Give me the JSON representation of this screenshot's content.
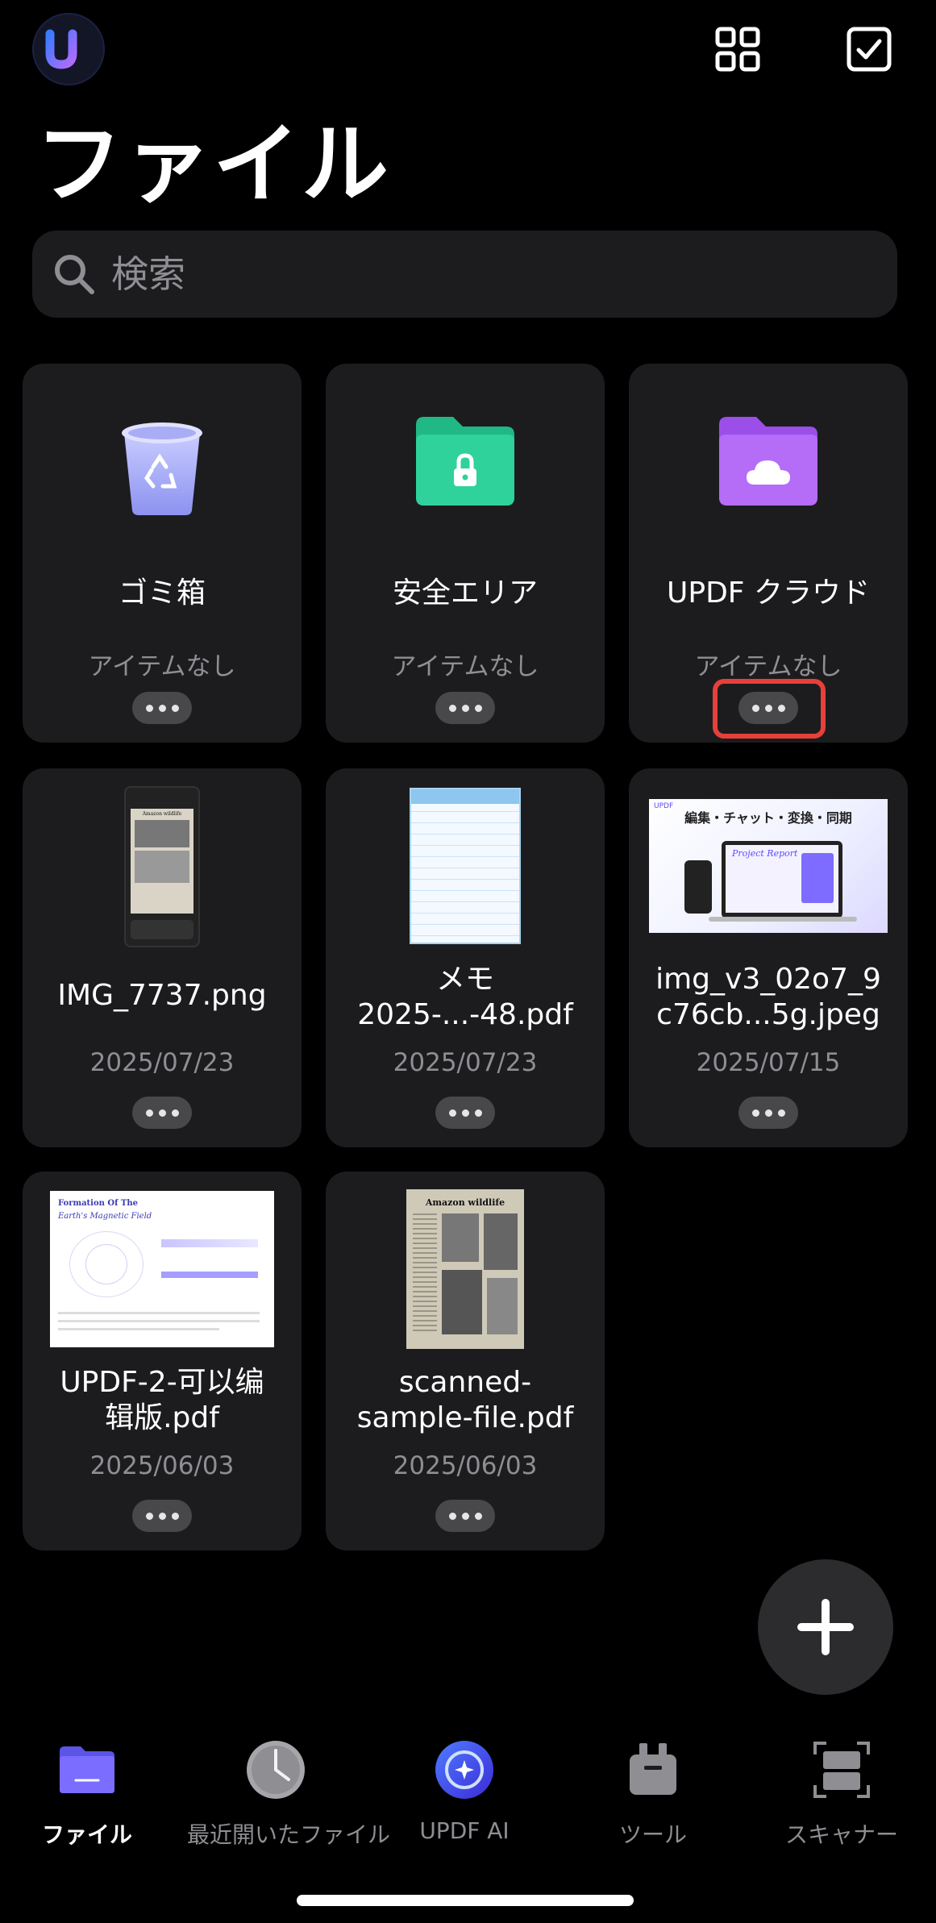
{
  "header": {
    "logo_letter": "u"
  },
  "page_title": "ファイル",
  "search": {
    "placeholder": "検索"
  },
  "cards": [
    {
      "name": "ゴミ箱",
      "meta": "アイテムなし",
      "type": "trash"
    },
    {
      "name": "安全エリア",
      "meta": "アイテムなし",
      "type": "secure-folder"
    },
    {
      "name": "UPDF クラウド",
      "meta": "アイテムなし",
      "type": "cloud-folder"
    },
    {
      "name": "IMG_7737.png",
      "meta": "2025/07/23",
      "type": "image",
      "thumb_title": "Amazon wildlife"
    },
    {
      "name": "メモ\n2025-...-48.pdf",
      "meta": "2025/07/23",
      "type": "memo"
    },
    {
      "name": "img_v3_02o7_9\nc76cb...5g.jpeg",
      "meta": "2025/07/15",
      "type": "image",
      "thumb_heading": "編集・チャット・変換・同期",
      "thumb_sub": "Project Report",
      "thumb_brand": "UPDF"
    },
    {
      "name": "UPDF-2-可以编\n辑版.pdf",
      "meta": "2025/06/03",
      "type": "pdf",
      "thumb_title_1": "Formation Of The",
      "thumb_title_2": "Earth's Magnetic Field"
    },
    {
      "name": "scanned-\nsample-file.pdf",
      "meta": "2025/06/03",
      "type": "pdf",
      "thumb_title": "Amazon wildlife"
    }
  ],
  "fab": {
    "icon": "plus-icon"
  },
  "tabs": [
    {
      "label": "ファイル",
      "icon": "folder-icon",
      "active": true
    },
    {
      "label": "最近開いたファイル",
      "icon": "clock-icon",
      "active": false
    },
    {
      "label": "UPDF AI",
      "icon": "ai-icon",
      "active": false
    },
    {
      "label": "ツール",
      "icon": "toolbox-icon",
      "active": false
    },
    {
      "label": "スキャナー",
      "icon": "scanner-icon",
      "active": false
    }
  ],
  "colors": {
    "accent": "#6a5bff",
    "card": "#1c1c1e",
    "highlight": "#e6403a"
  }
}
